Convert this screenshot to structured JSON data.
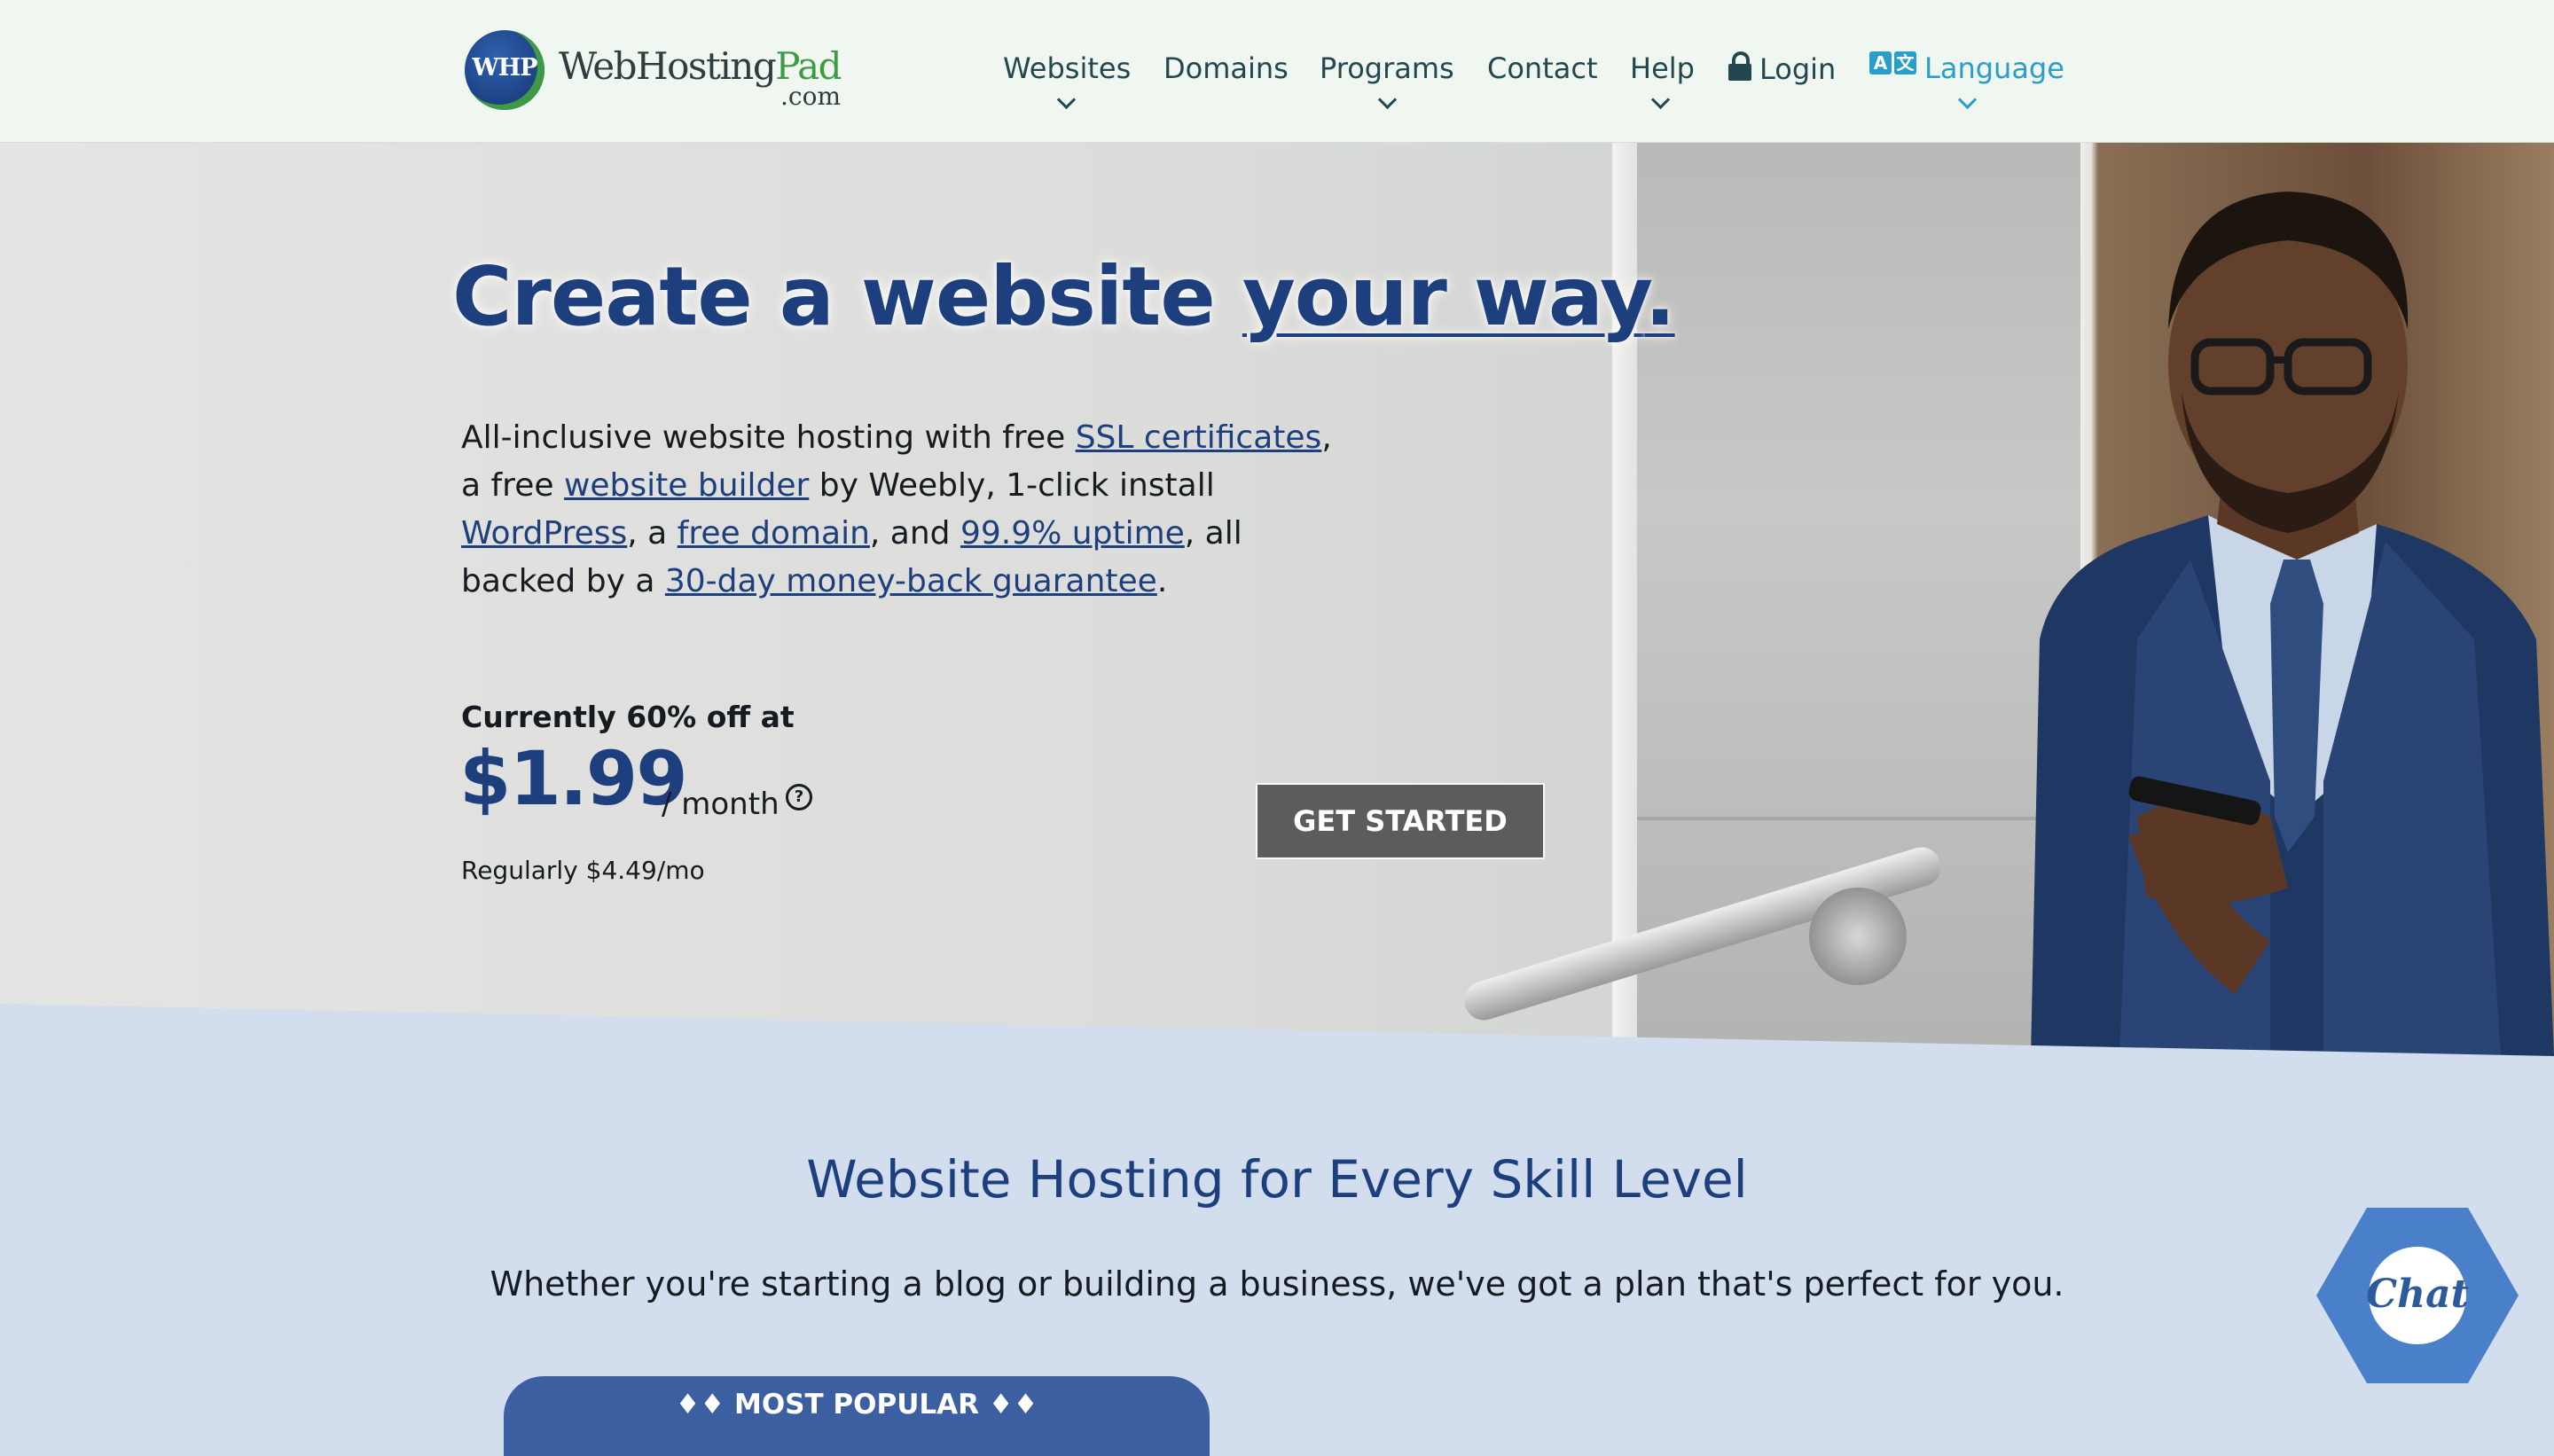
{
  "header": {
    "logo": {
      "badge": "WHP",
      "name_part1": "WebHosting",
      "name_part2": "Pad",
      "name_suffix": ".com"
    },
    "nav": [
      {
        "label": "Websites",
        "has_dropdown": true
      },
      {
        "label": "Domains",
        "has_dropdown": false
      },
      {
        "label": "Programs",
        "has_dropdown": true
      },
      {
        "label": "Contact",
        "has_dropdown": false
      },
      {
        "label": "Help",
        "has_dropdown": true
      },
      {
        "label": "Login",
        "icon": "lock-icon",
        "has_dropdown": false
      },
      {
        "label": "Language",
        "icon": "translate-icon",
        "has_dropdown": true,
        "color": "#2a9dc9"
      }
    ]
  },
  "hero": {
    "title_plain": "Create a website ",
    "title_underlined": "your way",
    "title_end": ".",
    "desc": {
      "t1": "All-inclusive website hosting with free ",
      "link_ssl": "SSL certificates",
      "t2": ", a free ",
      "link_builder": "website builder",
      "t3": " by Weebly, 1-click install ",
      "link_wordpress": "WordPress",
      "t4": ", a ",
      "link_domain": "free domain",
      "t5": ", and ",
      "link_uptime": "99.9% uptime",
      "t6": ", all backed by a ",
      "link_guarantee": "30-day money-back guarantee",
      "t7": "."
    },
    "price_lead": "Currently 60% off at",
    "price": "$1.99",
    "per": "/ month",
    "help_symbol": "?",
    "regular": "Regularly $4.49/mo",
    "cta": "GET STARTED"
  },
  "section": {
    "title": "Website Hosting for Every Skill Level",
    "subtitle": "Whether you're starting a blog or building a business, we've got a plan that's perfect for you.",
    "badge": "♦♦ MOST POPULAR ♦♦"
  },
  "chat": {
    "label": "Chat"
  },
  "colors": {
    "brand_blue": "#1e3f7e",
    "accent_green": "#3f9a45",
    "link_cyan": "#2a9dc9",
    "section_bg": "#d2deee"
  }
}
